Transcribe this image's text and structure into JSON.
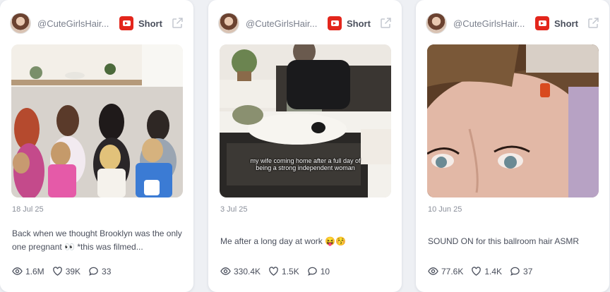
{
  "cards": [
    {
      "handle": "@CuteGirlsHair...",
      "platform_icon": "youtube-icon",
      "type": "Short",
      "thumb_caption": "",
      "date": "18 Jul 25",
      "description": "Back when we thought Brooklyn was the only one pregnant 👀  *this was filmed...",
      "views": "1.6M",
      "likes": "39K",
      "comments": "33"
    },
    {
      "handle": "@CuteGirlsHair...",
      "platform_icon": "youtube-icon",
      "type": "Short",
      "thumb_caption": "my wife coming home after a full day of being a strong independent woman",
      "date": "3 Jul 25",
      "description": "Me after a long day at work 😝😚",
      "views": "330.4K",
      "likes": "1.5K",
      "comments": "10"
    },
    {
      "handle": "@CuteGirlsHair...",
      "platform_icon": "youtube-icon",
      "type": "Short",
      "thumb_caption": "",
      "date": "10 Jun 25",
      "description": "SOUND ON for this ballroom hair ASMR",
      "views": "77.6K",
      "likes": "1.4K",
      "comments": "37"
    }
  ],
  "colors": {
    "background": "#eef0f4",
    "card": "#ffffff",
    "youtube": "#e3261c",
    "muted_text": "#8a8f9a",
    "body_text": "#4a4f5c"
  }
}
